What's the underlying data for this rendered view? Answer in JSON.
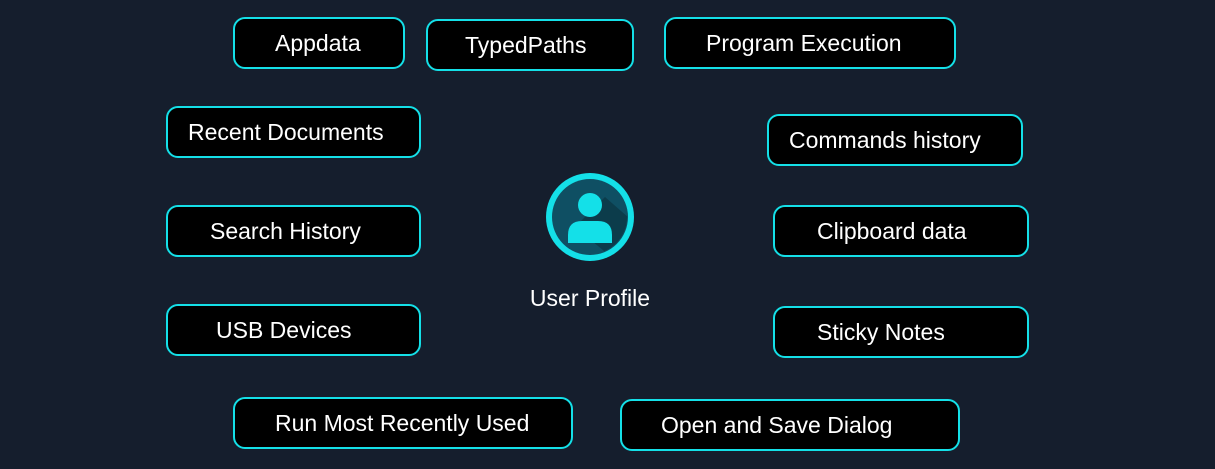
{
  "center": {
    "icon": "user-profile-icon",
    "label": "User Profile"
  },
  "nodes": [
    {
      "id": "appdata",
      "label": "Appdata"
    },
    {
      "id": "typedpaths",
      "label": "TypedPaths"
    },
    {
      "id": "program-execution",
      "label": "Program Execution"
    },
    {
      "id": "recent-documents",
      "label": "Recent Documents"
    },
    {
      "id": "commands-history",
      "label": "Commands history"
    },
    {
      "id": "search-history",
      "label": "Search History"
    },
    {
      "id": "clipboard-data",
      "label": "Clipboard data"
    },
    {
      "id": "usb-devices",
      "label": "USB Devices"
    },
    {
      "id": "sticky-notes",
      "label": "Sticky Notes"
    },
    {
      "id": "run-mru",
      "label": "Run Most Recently Used"
    },
    {
      "id": "open-save-dialog",
      "label": "Open and Save Dialog"
    }
  ],
  "colors": {
    "background": "#151e2d",
    "node_fill": "#000000",
    "node_border": "#14e0e8",
    "icon_cyan": "#14e0e8",
    "icon_ring": "#0f4f63",
    "text": "#ffffff"
  }
}
